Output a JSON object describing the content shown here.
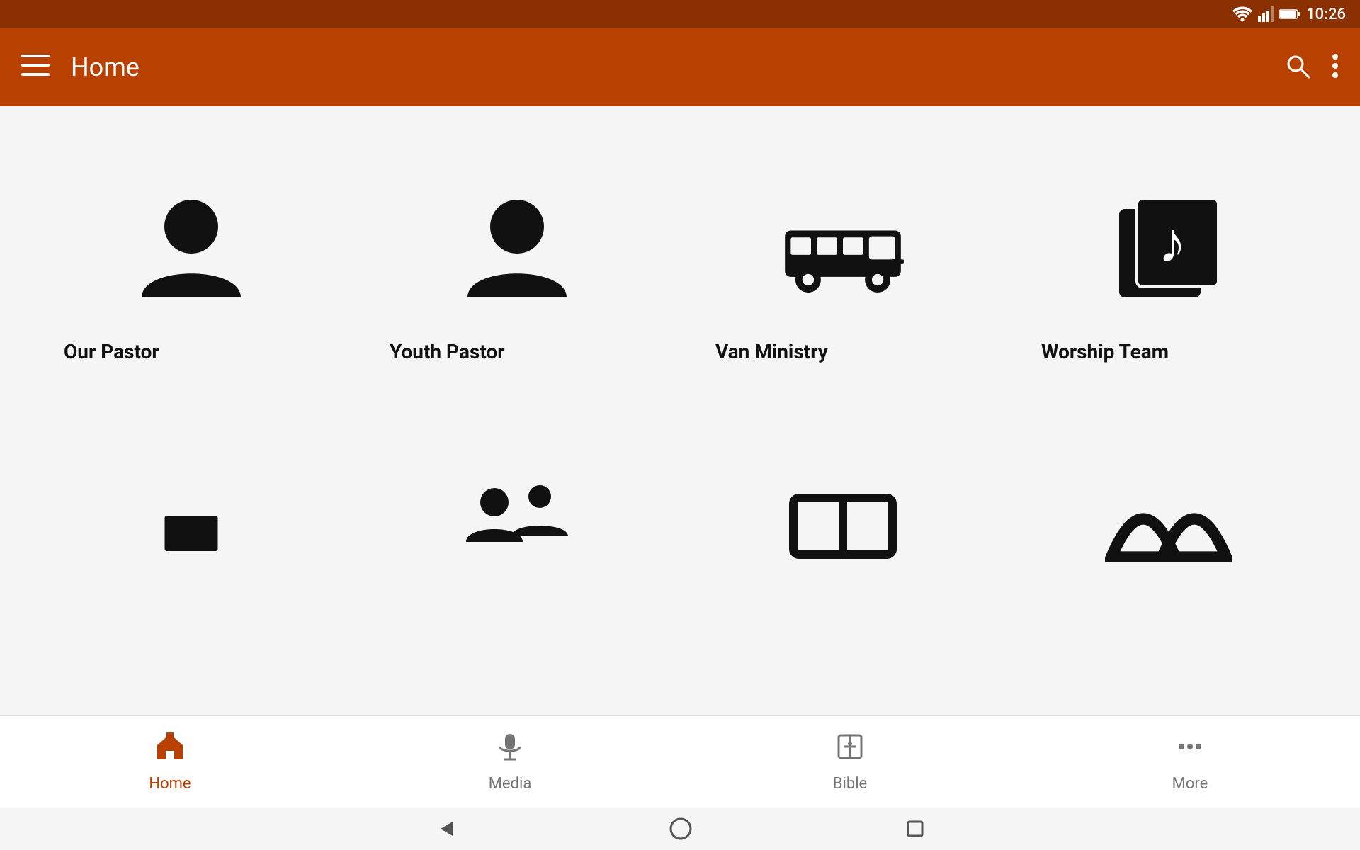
{
  "statusBar": {
    "time": "10:26"
  },
  "appBar": {
    "menuIcon": "≡",
    "title": "Home",
    "searchIcon": "search",
    "moreIcon": "⋮"
  },
  "grid": {
    "items": [
      {
        "id": "our-pastor",
        "label": "Our Pastor",
        "iconType": "person"
      },
      {
        "id": "youth-pastor",
        "label": "Youth Pastor",
        "iconType": "person"
      },
      {
        "id": "van-ministry",
        "label": "Van Ministry",
        "iconType": "van"
      },
      {
        "id": "worship-team",
        "label": "Worship Team",
        "iconType": "music"
      }
    ],
    "secondRowItems": [
      {
        "id": "item5",
        "iconType": "person-partial"
      },
      {
        "id": "item6",
        "iconType": "group-partial"
      },
      {
        "id": "item7",
        "iconType": "tablet-partial"
      },
      {
        "id": "item8",
        "iconType": "mountain-partial"
      }
    ]
  },
  "bottomNav": {
    "items": [
      {
        "id": "home",
        "label": "Home",
        "icon": "home",
        "active": true
      },
      {
        "id": "media",
        "label": "Media",
        "icon": "mic",
        "active": false
      },
      {
        "id": "bible",
        "label": "Bible",
        "icon": "bible",
        "active": false
      },
      {
        "id": "more",
        "label": "More",
        "icon": "more",
        "active": false
      }
    ]
  }
}
